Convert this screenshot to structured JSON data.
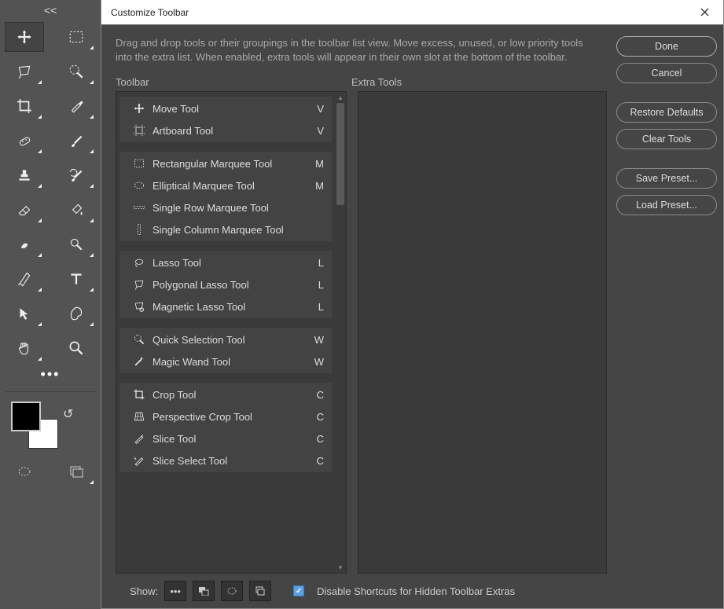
{
  "dialog": {
    "title": "Customize Toolbar",
    "instructions": "Drag and drop tools or their groupings in the toolbar list view. Move excess, unused, or low priority tools into the extra list. When enabled, extra tools will appear in their own slot at the bottom of the toolbar.",
    "toolbar_label": "Toolbar",
    "extra_label": "Extra Tools",
    "buttons": {
      "done": "Done",
      "cancel": "Cancel",
      "restore": "Restore Defaults",
      "clear": "Clear Tools",
      "save_preset": "Save Preset...",
      "load_preset": "Load Preset..."
    },
    "show_label": "Show:",
    "disable_label": "Disable Shortcuts for Hidden Toolbar Extras",
    "disable_checked": true
  },
  "left_toolbar": {
    "collapse": "<<",
    "tools": [
      {
        "icon": "move",
        "selected": true,
        "flyout": false
      },
      {
        "icon": "marquee-rect",
        "selected": false,
        "flyout": true
      },
      {
        "icon": "lasso-polygon",
        "selected": false,
        "flyout": true
      },
      {
        "icon": "quick-select",
        "selected": false,
        "flyout": true
      },
      {
        "icon": "crop",
        "selected": false,
        "flyout": true
      },
      {
        "icon": "eyedropper",
        "selected": false,
        "flyout": true
      },
      {
        "icon": "healing",
        "selected": false,
        "flyout": true
      },
      {
        "icon": "brush",
        "selected": false,
        "flyout": true
      },
      {
        "icon": "stamp",
        "selected": false,
        "flyout": true
      },
      {
        "icon": "history-brush",
        "selected": false,
        "flyout": true
      },
      {
        "icon": "eraser",
        "selected": false,
        "flyout": true
      },
      {
        "icon": "paint-bucket",
        "selected": false,
        "flyout": true
      },
      {
        "icon": "smudge",
        "selected": false,
        "flyout": true
      },
      {
        "icon": "dodge",
        "selected": false,
        "flyout": true
      },
      {
        "icon": "pen",
        "selected": false,
        "flyout": true
      },
      {
        "icon": "type",
        "selected": false,
        "flyout": true
      },
      {
        "icon": "path-select",
        "selected": false,
        "flyout": true
      },
      {
        "icon": "shape",
        "selected": false,
        "flyout": true
      },
      {
        "icon": "hand",
        "selected": false,
        "flyout": true
      },
      {
        "icon": "zoom",
        "selected": false,
        "flyout": false
      }
    ]
  },
  "groups": [
    {
      "items": [
        {
          "icon": "move",
          "label": "Move Tool",
          "key": "V"
        },
        {
          "icon": "artboard",
          "label": "Artboard Tool",
          "key": "V"
        }
      ]
    },
    {
      "items": [
        {
          "icon": "marquee-rect",
          "label": "Rectangular Marquee Tool",
          "key": "M"
        },
        {
          "icon": "marquee-ellipse",
          "label": "Elliptical Marquee Tool",
          "key": "M"
        },
        {
          "icon": "marquee-row",
          "label": "Single Row Marquee Tool",
          "key": ""
        },
        {
          "icon": "marquee-col",
          "label": "Single Column Marquee Tool",
          "key": ""
        }
      ]
    },
    {
      "items": [
        {
          "icon": "lasso",
          "label": "Lasso Tool",
          "key": "L"
        },
        {
          "icon": "lasso-polygon",
          "label": "Polygonal Lasso Tool",
          "key": "L"
        },
        {
          "icon": "lasso-magnetic",
          "label": "Magnetic Lasso Tool",
          "key": "L"
        }
      ]
    },
    {
      "items": [
        {
          "icon": "quick-select",
          "label": "Quick Selection Tool",
          "key": "W"
        },
        {
          "icon": "magic-wand",
          "label": "Magic Wand Tool",
          "key": "W"
        }
      ]
    },
    {
      "items": [
        {
          "icon": "crop",
          "label": "Crop Tool",
          "key": "C"
        },
        {
          "icon": "perspective-crop",
          "label": "Perspective Crop Tool",
          "key": "C"
        },
        {
          "icon": "slice",
          "label": "Slice Tool",
          "key": "C"
        },
        {
          "icon": "slice-select",
          "label": "Slice Select Tool",
          "key": "C"
        }
      ]
    }
  ]
}
